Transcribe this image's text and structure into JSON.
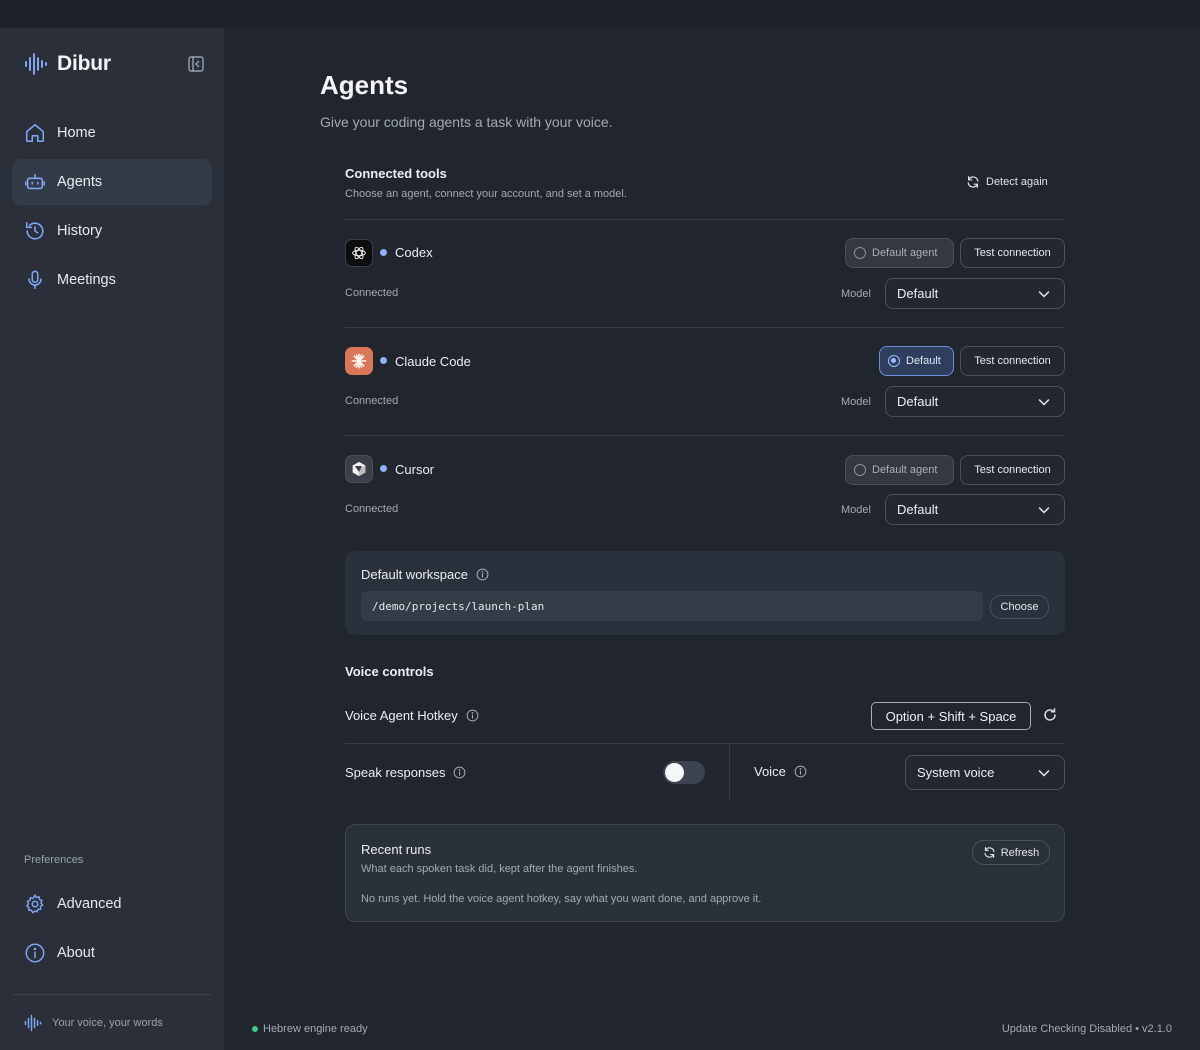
{
  "app": {
    "name": "Dibur",
    "tagline": "Your voice, your words",
    "colors": {
      "accent": "#7fa6f5",
      "success": "#3fc88a",
      "claude": "#d9765a"
    }
  },
  "sidebar": {
    "items": [
      {
        "label": "Home",
        "icon": "home-icon"
      },
      {
        "label": "Agents",
        "icon": "robot-icon",
        "active": true
      },
      {
        "label": "History",
        "icon": "history-icon"
      },
      {
        "label": "Meetings",
        "icon": "microphone-icon"
      }
    ],
    "preferences_label": "Preferences",
    "preferences": [
      {
        "label": "Advanced",
        "icon": "gear-icon"
      },
      {
        "label": "About",
        "icon": "info-icon"
      }
    ]
  },
  "page": {
    "title": "Agents",
    "subtitle": "Give your coding agents a task with your voice."
  },
  "connected_tools": {
    "title": "Connected tools",
    "subtitle": "Choose an agent, connect your account, and set a model.",
    "detect_label": "Detect again",
    "model_label": "Model",
    "test_label": "Test connection",
    "agents": [
      {
        "name": "Codex",
        "status": "Connected",
        "default_label": "Default agent",
        "is_default": false,
        "model": "Default"
      },
      {
        "name": "Claude Code",
        "status": "Connected",
        "default_label": "Default",
        "is_default": true,
        "model": "Default"
      },
      {
        "name": "Cursor",
        "status": "Connected",
        "default_label": "Default agent",
        "is_default": false,
        "model": "Default"
      }
    ]
  },
  "workspace": {
    "title": "Default workspace",
    "path": "/demo/projects/launch-plan",
    "choose_label": "Choose"
  },
  "voice_controls": {
    "title": "Voice controls",
    "hotkey_label": "Voice Agent Hotkey",
    "hotkey_value": "Option + Shift + Space",
    "speak_label": "Speak responses",
    "speak_enabled": false,
    "voice_label": "Voice",
    "voice_value": "System voice"
  },
  "recent_runs": {
    "title": "Recent runs",
    "subtitle": "What each spoken task did, kept after the agent finishes.",
    "empty": "No runs yet. Hold the voice agent hotkey, say what you want done, and approve it.",
    "refresh_label": "Refresh"
  },
  "footer": {
    "status": "Hebrew engine ready",
    "right": "Update Checking Disabled • v2.1.0"
  }
}
